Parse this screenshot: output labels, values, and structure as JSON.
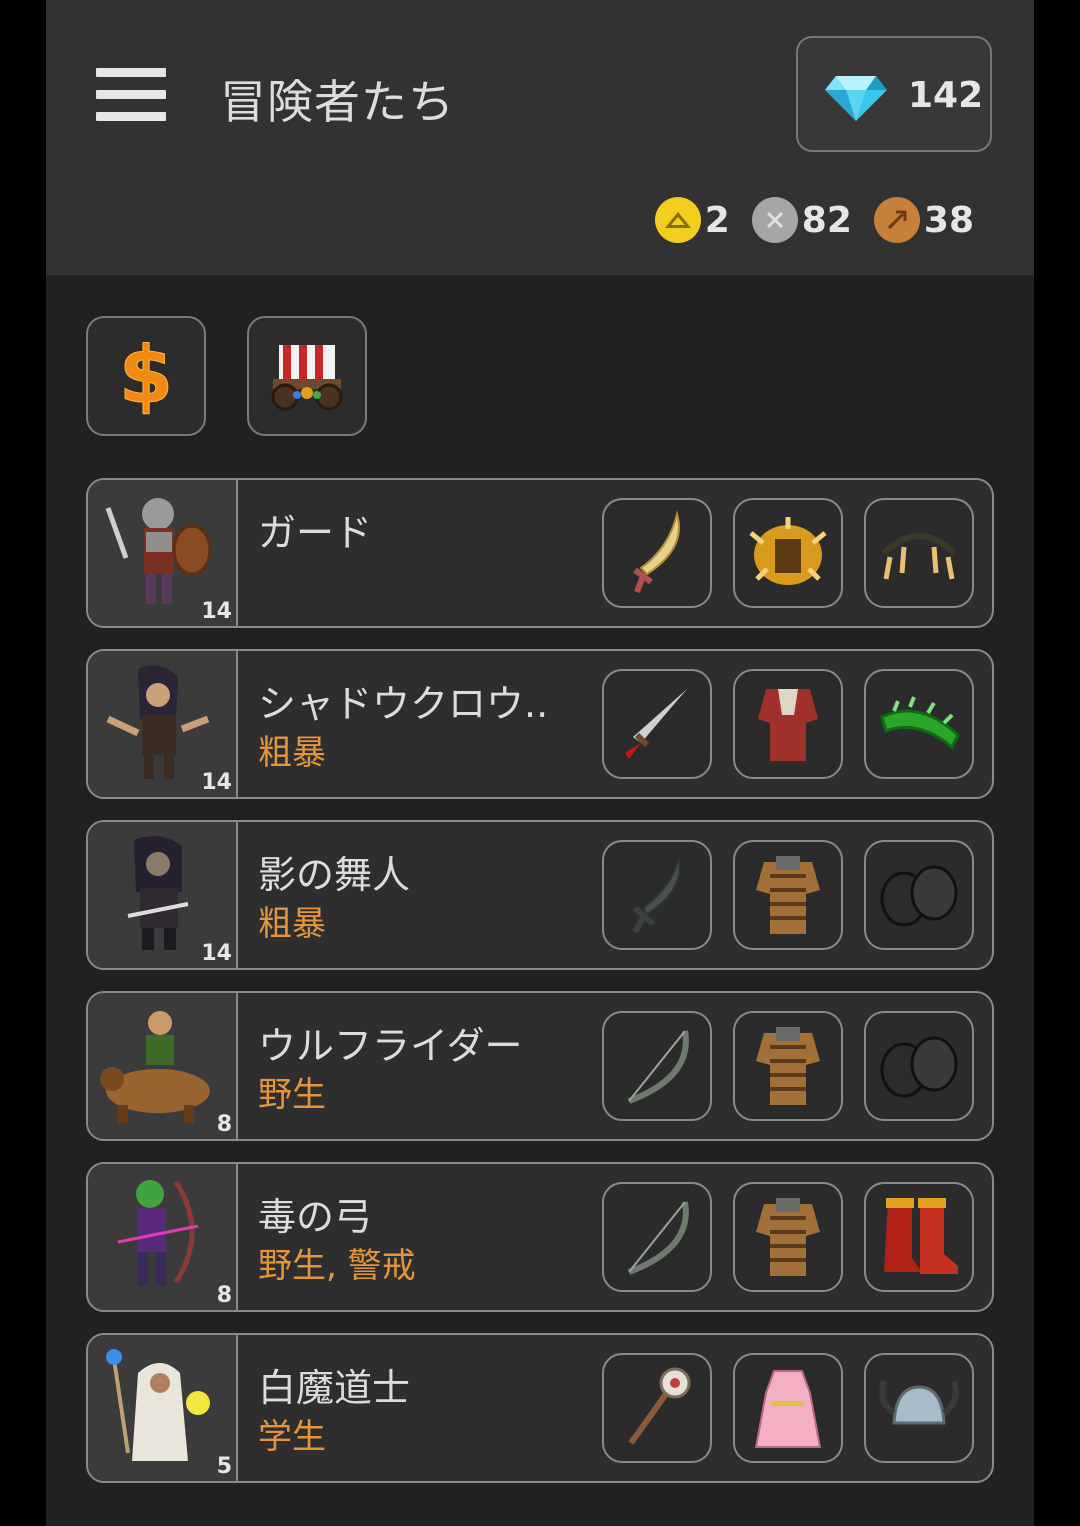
{
  "header": {
    "title": "冒険者たち",
    "gems": "142",
    "currencies": [
      {
        "icon": "gold-coin-icon",
        "value": "2",
        "color": "#f2cf1d"
      },
      {
        "icon": "silver-coin-icon",
        "value": "82",
        "color": "#a6a6a6"
      },
      {
        "icon": "bronze-coin-icon",
        "value": "38",
        "color": "#c7803a"
      }
    ]
  },
  "actions": [
    {
      "icon": "dollar-icon"
    },
    {
      "icon": "wagon-icon"
    }
  ],
  "adventurers": [
    {
      "name": "ガード",
      "trait": "",
      "level": "14",
      "equipment": [
        "scimitar-icon",
        "spiked-armor-icon",
        "claw-gloves-icon"
      ]
    },
    {
      "name": "シャドウクロウ..",
      "trait": "粗暴",
      "level": "14",
      "equipment": [
        "bloody-dagger-icon",
        "red-armor-icon",
        "green-gloves-icon"
      ]
    },
    {
      "name": "影の舞人",
      "trait": "粗暴",
      "level": "14",
      "equipment": [
        "dark-sword-icon",
        "leather-armor-icon",
        "dark-gauntlets-icon"
      ]
    },
    {
      "name": "ウルフライダー",
      "trait": "野生",
      "level": "8",
      "equipment": [
        "bow-icon",
        "leather-armor-icon",
        "dark-gauntlets-icon"
      ]
    },
    {
      "name": "毒の弓",
      "trait": "野生, 警戒",
      "level": "8",
      "equipment": [
        "bow-icon",
        "leather-armor-icon",
        "red-boots-icon"
      ]
    },
    {
      "name": "白魔道士",
      "trait": "学生",
      "level": "5",
      "equipment": [
        "staff-icon",
        "pink-dress-icon",
        "horned-helmet-icon"
      ]
    }
  ]
}
